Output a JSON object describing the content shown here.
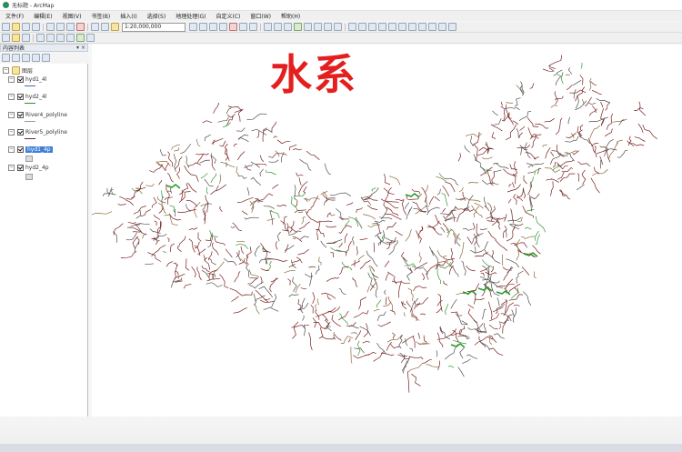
{
  "window": {
    "title": "无标题 - ArcMap",
    "app_icon": "arcmap-icon"
  },
  "menu": [
    "文件(F)",
    "编辑(E)",
    "视图(V)",
    "书签(B)",
    "插入(I)",
    "选择(S)",
    "地理处理(G)",
    "自定义(C)",
    "窗口(W)",
    "帮助(H)"
  ],
  "toolbar": {
    "scale": "1:20,000,000"
  },
  "toc": {
    "title": "内容列表",
    "controls": "▾ ×",
    "root": "图层",
    "layers": [
      {
        "name": "hyd1_4l",
        "symbol_color": "#3a6fb0",
        "symbol": "line"
      },
      {
        "name": "hyd2_4l",
        "symbol_color": "#2f8a2f",
        "symbol": "line"
      },
      {
        "name": "River4_polyline",
        "symbol_color": "#9a9a9a",
        "symbol": "line"
      },
      {
        "name": "River5_polyline",
        "symbol_color": "#6e2d2d",
        "symbol": "line"
      },
      {
        "name": "hyd1_4p",
        "symbol_color": "#cccccc",
        "symbol": "fill",
        "selected": true
      },
      {
        "name": "hyd2_4p",
        "symbol_color": "#cccccc",
        "symbol": "fill"
      }
    ]
  },
  "map": {
    "title": "水系",
    "title_color": "#e31f1f",
    "river_colors": [
      "#7a1f1f",
      "#4f4f4f",
      "#2c9a2c",
      "#8a6a3a"
    ]
  }
}
